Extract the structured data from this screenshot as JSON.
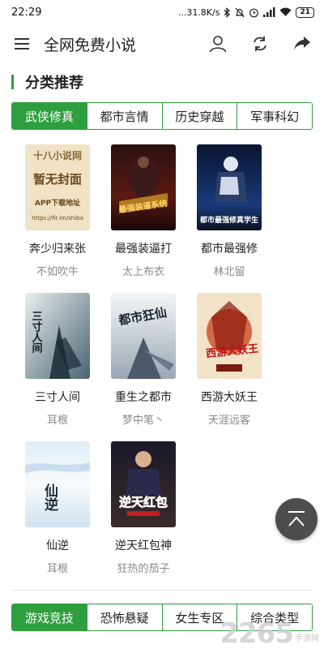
{
  "status_bar": {
    "time": "22:29",
    "network_speed": "...31.8K/s",
    "battery": "21"
  },
  "app_bar": {
    "title": "全网免费小说",
    "icons": [
      "menu-icon",
      "user-icon",
      "refresh-icon",
      "share-icon"
    ]
  },
  "section": {
    "title": "分类推荐"
  },
  "tabs": [
    {
      "label": "武侠修真",
      "active": true
    },
    {
      "label": "都市言情",
      "active": false
    },
    {
      "label": "历史穿越",
      "active": false
    },
    {
      "label": "军事科幻",
      "active": false
    }
  ],
  "books": [
    {
      "title": "奔少归来张",
      "author": "不如吹牛",
      "cover_text": [
        "十八小说网",
        "暂无封面",
        "APP下载地址",
        "https://fir.im/shiba"
      ]
    },
    {
      "title": "最强装逼打",
      "author": "太上布衣",
      "cover_text": [
        "最强装逼系统"
      ]
    },
    {
      "title": "都市最强修",
      "author": "林北留",
      "cover_text": [
        "都市最强修真学生"
      ]
    },
    {
      "title": "三寸人间",
      "author": "耳根",
      "cover_text": [
        "三寸人间"
      ]
    },
    {
      "title": "重生之都市",
      "author": "梦中笔丶",
      "cover_text": [
        "都市狂仙"
      ]
    },
    {
      "title": "西游大妖王",
      "author": "天涯远客",
      "cover_text": [
        "西游大妖王"
      ]
    },
    {
      "title": "仙逆",
      "author": "耳根",
      "cover_text": [
        "仙逆"
      ]
    },
    {
      "title": "逆天红包神",
      "author": "狂热的茄子",
      "cover_text": [
        "逆天红包"
      ]
    }
  ],
  "tabs2": [
    {
      "label": "游戏竞技",
      "active": true
    },
    {
      "label": "恐怖悬疑",
      "active": false
    },
    {
      "label": "女生专区",
      "active": false
    },
    {
      "label": "综合类型",
      "active": false
    }
  ],
  "watermark": {
    "logo": "2265",
    "text": "手游网"
  },
  "colors": {
    "accent": "#2e9e3e",
    "fab": "#4d4d4d"
  }
}
